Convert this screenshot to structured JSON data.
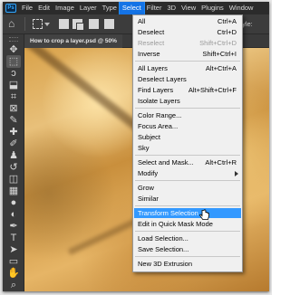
{
  "menubar": {
    "logo": "Ps",
    "items": [
      "File",
      "Edit",
      "Image",
      "Layer",
      "Type",
      "Select",
      "Filter",
      "3D",
      "View",
      "Plugins",
      "Window"
    ],
    "active": "Select"
  },
  "options_bar": {
    "style_label": "Style:"
  },
  "document_tab": {
    "title": "How to crop a layer.psd @ 50%"
  },
  "select_menu": {
    "items": [
      {
        "label": "All",
        "shortcut": "Ctrl+A"
      },
      {
        "label": "Deselect",
        "shortcut": "Ctrl+D"
      },
      {
        "label": "Reselect",
        "shortcut": "Shift+Ctrl+D",
        "disabled": true
      },
      {
        "label": "Inverse",
        "shortcut": "Shift+Ctrl+I"
      },
      {
        "label": "All Layers",
        "shortcut": "Alt+Ctrl+A"
      },
      {
        "label": "Deselect Layers",
        "shortcut": ""
      },
      {
        "label": "Find Layers",
        "shortcut": "Alt+Shift+Ctrl+F"
      },
      {
        "label": "Isolate Layers",
        "shortcut": ""
      },
      {
        "label": "Color Range...",
        "shortcut": ""
      },
      {
        "label": "Focus Area...",
        "shortcut": ""
      },
      {
        "label": "Subject",
        "shortcut": ""
      },
      {
        "label": "Sky",
        "shortcut": ""
      },
      {
        "label": "Select and Mask...",
        "shortcut": "Alt+Ctrl+R"
      },
      {
        "label": "Modify",
        "shortcut": "",
        "submenu": true
      },
      {
        "label": "Grow",
        "shortcut": ""
      },
      {
        "label": "Similar",
        "shortcut": ""
      },
      {
        "label": "Transform Selection",
        "shortcut": "",
        "highlighted": true
      },
      {
        "label": "Edit in Quick Mask Mode",
        "shortcut": ""
      },
      {
        "label": "Load Selection...",
        "shortcut": ""
      },
      {
        "label": "Save Selection...",
        "shortcut": ""
      },
      {
        "label": "New 3D Extrusion",
        "shortcut": ""
      }
    ]
  },
  "toolbar": {
    "tools": [
      {
        "icon": "move-tool-icon",
        "glyph": "✥"
      },
      {
        "icon": "rectangular-marquee-icon",
        "glyph": "⬚",
        "selected": true
      },
      {
        "icon": "lasso-icon",
        "glyph": "ↄ"
      },
      {
        "icon": "object-selection-icon",
        "glyph": "⬓"
      },
      {
        "icon": "crop-icon",
        "glyph": "⌗"
      },
      {
        "icon": "frame-icon",
        "glyph": "⊠"
      },
      {
        "icon": "eyedropper-icon",
        "glyph": "✎"
      },
      {
        "icon": "healing-brush-icon",
        "glyph": "✚"
      },
      {
        "icon": "brush-icon",
        "glyph": "✐"
      },
      {
        "icon": "clone-stamp-icon",
        "glyph": "♟"
      },
      {
        "icon": "history-brush-icon",
        "glyph": "↺"
      },
      {
        "icon": "eraser-icon",
        "glyph": "◫"
      },
      {
        "icon": "gradient-icon",
        "glyph": "▦"
      },
      {
        "icon": "blur-icon",
        "glyph": "●"
      },
      {
        "icon": "dodge-icon",
        "glyph": "◐"
      },
      {
        "icon": "pen-icon",
        "glyph": "✒"
      },
      {
        "icon": "type-icon",
        "glyph": "T"
      },
      {
        "icon": "path-selection-icon",
        "glyph": "➤"
      },
      {
        "icon": "rectangle-shape-icon",
        "glyph": "▭"
      },
      {
        "icon": "hand-icon",
        "glyph": "✋"
      },
      {
        "icon": "zoom-icon",
        "glyph": "⌕"
      }
    ]
  }
}
